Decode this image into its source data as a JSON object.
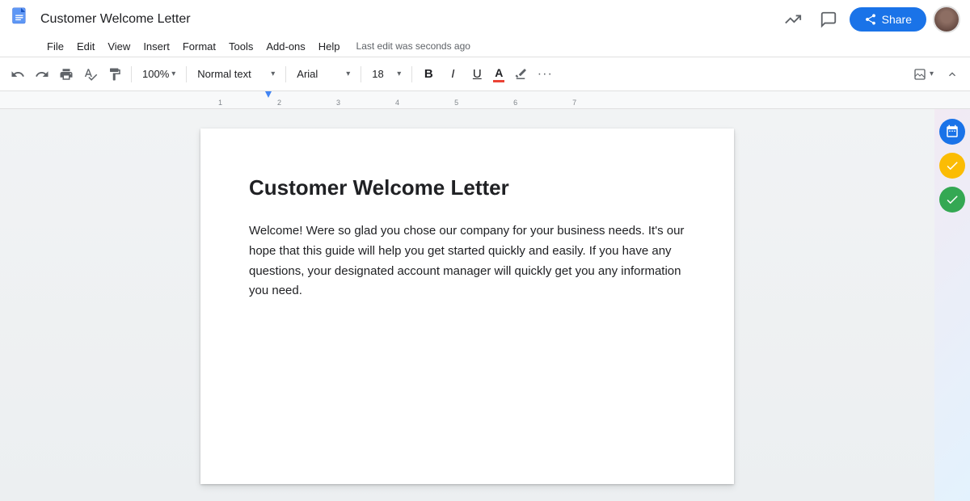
{
  "app": {
    "title": "Customer Welcome Letter",
    "doc_icon_label": "Google Docs",
    "last_edit": "Last edit was seconds ago"
  },
  "menu": {
    "items": [
      "File",
      "Edit",
      "View",
      "Insert",
      "Format",
      "Tools",
      "Add-ons",
      "Help"
    ]
  },
  "header": {
    "share_label": "Share",
    "share_icon": "👥"
  },
  "toolbar": {
    "undo_label": "↺",
    "redo_label": "↻",
    "print_label": "🖨",
    "spell_label": "✓",
    "paint_label": "🖌",
    "zoom_value": "100%",
    "zoom_chevron": "▾",
    "style_value": "Normal text",
    "style_chevron": "▾",
    "font_value": "Arial",
    "font_chevron": "▾",
    "size_value": "18",
    "size_chevron": "▾",
    "bold_label": "B",
    "italic_label": "I",
    "underline_label": "U",
    "font_color_label": "A",
    "highlight_label": "✏",
    "more_label": "···",
    "format_image_label": "⊡",
    "collapse_label": "∧"
  },
  "document": {
    "heading": "Customer Welcome Letter",
    "body": "Welcome! Were so glad you chose our company for your business needs. It's our hope that this guide will help you get started quickly and easily. If you have any questions, your designated account manager will quickly get you any information you need."
  },
  "sidebar": {
    "calendar_icon": "📅",
    "tasks_icon": "✔",
    "meet_icon": "✓"
  },
  "ruler": {
    "marks": [
      "1",
      "2",
      "3",
      "4",
      "5",
      "6",
      "7"
    ]
  }
}
